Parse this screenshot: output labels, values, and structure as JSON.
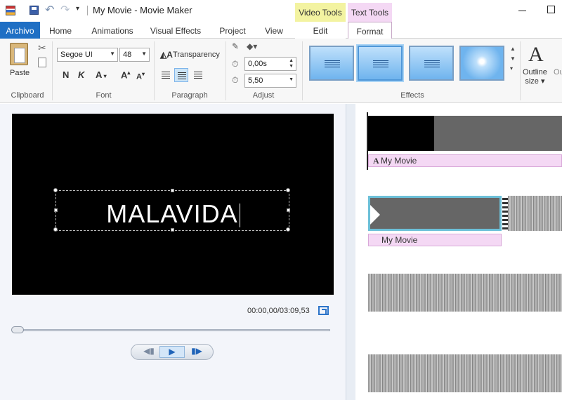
{
  "window": {
    "title": "My Movie - Movie Maker",
    "contextual_tab_video": "Video Tools",
    "contextual_tab_text": "Text Tools"
  },
  "tabs": {
    "archivo": "Archivo",
    "home": "Home",
    "animations": "Animations",
    "visual_effects": "Visual Effects",
    "project": "Project",
    "view": "View",
    "edit": "Edit",
    "format": "Format",
    "active": "Format"
  },
  "ribbon": {
    "clipboard": {
      "group_label": "Clipboard",
      "paste_label": "Paste"
    },
    "font": {
      "group_label": "Font",
      "family": "Segoe UI",
      "size": "48",
      "bold": "N",
      "italic": "K",
      "color_glyph": "A",
      "grow_glyph": "A",
      "shrink_glyph": "A"
    },
    "paragraph": {
      "group_label": "Paragraph",
      "transparency_label": "Transparency",
      "selected_align": "center"
    },
    "adjust": {
      "group_label": "Adjust",
      "start_time": "0,00s",
      "duration": "5,50"
    },
    "effects": {
      "group_label": "Effects",
      "selected_index": 1
    },
    "outline": {
      "label": "Outline",
      "sub_label": "size",
      "cut_label": "Ou"
    }
  },
  "preview": {
    "caption_text": "MALAVIDA",
    "timecode": "00:00,00/03:09,53",
    "seek_position": 0.0
  },
  "storyboard": {
    "title_clip_label": "My Movie",
    "caption_label": "My Movie"
  },
  "colors": {
    "accent_blue": "#1f6fc4",
    "video_tools": "#f3f3a1",
    "text_tools": "#f4d8f4"
  }
}
